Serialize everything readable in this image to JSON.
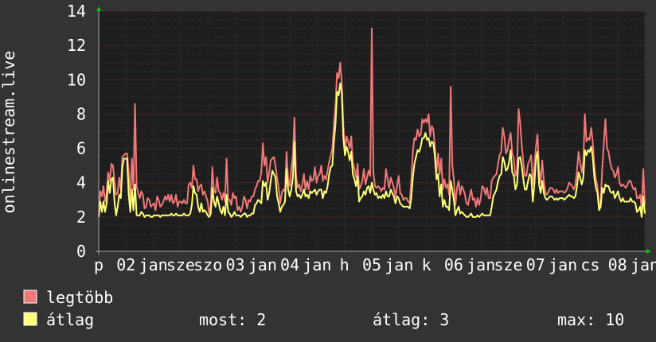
{
  "chart_data": {
    "type": "area",
    "ylabel": "onlinestream.live",
    "ylim": [
      0,
      14
    ],
    "y_ticks": [
      0,
      2,
      4,
      6,
      8,
      10,
      12,
      14
    ],
    "x_tick_labels": [
      "p",
      "02",
      "jan",
      "sze",
      "szo",
      "03",
      "jan",
      "04",
      "jan",
      "h",
      "05",
      "jan",
      "k",
      "06",
      "jan",
      "sze",
      "07",
      "jan",
      "cs",
      "08",
      "jan"
    ],
    "grid": true,
    "colors": {
      "background": "#333333",
      "plot_background": "#1e1e1e",
      "grid_major": "#6a2e2e",
      "grid_minor": "#3c3c3c",
      "legtobb": "#f07878",
      "atlag": "#ffff78",
      "arrow": "#00cc00"
    },
    "series": [
      {
        "name": "legtöbb",
        "color": "#f07878",
        "values": [
          2.1,
          3.5,
          3.2,
          3.8,
          2.9,
          3.4,
          4.6,
          4.1,
          5.1,
          5,
          4.1,
          3.3,
          3.4,
          4.3,
          3.6,
          5.5,
          5.6,
          5.7,
          5.7,
          4.6,
          2.9,
          5.4,
          3.6,
          8.6,
          3.8,
          3.4,
          3.1,
          3.5,
          3.3,
          2.5,
          2.6,
          3.1,
          3,
          2.6,
          2.7,
          2.8,
          2.4,
          3.2,
          3,
          2.6,
          2.7,
          2.9,
          3.2,
          3,
          3.3,
          2.9,
          3.3,
          2.8,
          2.9,
          3.3,
          2.6,
          2.9,
          2.9,
          2.8,
          3,
          2.8,
          2.8,
          3.9,
          4,
          3.7,
          5,
          4.2,
          4.2,
          3.5,
          3.8,
          3.9,
          3.3,
          3.5,
          3.2,
          2.9,
          2.2,
          2.7,
          4.9,
          3.5,
          3.4,
          4.3,
          3.5,
          3.4,
          3,
          3.4,
          2.9,
          5.4,
          3,
          3,
          2.7,
          3.4,
          3.1,
          3.2,
          2.4,
          2.6,
          2.3,
          2.6,
          3.2,
          3,
          2.5,
          3,
          2.9,
          3.2,
          3.2,
          3.6,
          3.8,
          4.1,
          4.1,
          4.6,
          6.3,
          5,
          5.5,
          4,
          4.6,
          5.3,
          5.4,
          5.5,
          5,
          4.3,
          3.7,
          2.8,
          3.4,
          3.6,
          3.5,
          5.8,
          4.2,
          3.8,
          4.8,
          5.6,
          7.8,
          4.5,
          3.7,
          3.9,
          3.5,
          3.9,
          4.5,
          3.6,
          4.1,
          3.6,
          4.4,
          4.1,
          4.2,
          4.9,
          4,
          4.4,
          4.5,
          5,
          4.1,
          4.4,
          4.2,
          4.7,
          5.2,
          5.6,
          6,
          7.4,
          8.5,
          10.4,
          10.1,
          11,
          9.8,
          7.3,
          5.9,
          6.7,
          6.4,
          6,
          6.7,
          5.2,
          4.8,
          4.3,
          5.1,
          3.6,
          3.8,
          4.1,
          4.8,
          3.9,
          4.3,
          4.7,
          4.4,
          13,
          4.6,
          3.8,
          3.7,
          3.8,
          3.7,
          3.5,
          3.7,
          3.6,
          4.8,
          4.2,
          3.7,
          4.3,
          4,
          3.7,
          3.2,
          3.8,
          4.4,
          3.4,
          3.3,
          3,
          3.1,
          3.1,
          2.9,
          2.8,
          4.1,
          5.8,
          6.6,
          6.5,
          7.1,
          6.7,
          6.8,
          7.7,
          7.5,
          7.7,
          7.5,
          8,
          6.7,
          7.3,
          7.1,
          6.1,
          4.6,
          5.7,
          4.5,
          5.4,
          3.6,
          4.2,
          3.7,
          3.9,
          3.3,
          9.6,
          5,
          4.2,
          2.7,
          3.7,
          4.1,
          3.3,
          3.8,
          3.6,
          3.3,
          2.8,
          2.7,
          3.2,
          3.6,
          3,
          3.1,
          2.6,
          3.1,
          2.7,
          3.1,
          3.8,
          3.7,
          3.3,
          3.7,
          3.1,
          3.1,
          4.1,
          4.3,
          4.4,
          4.5,
          5.1,
          5.6,
          5.8,
          7.2,
          6.7,
          5.7,
          5.9,
          6.5,
          6.9,
          5.7,
          5.4,
          4.4,
          4.7,
          8.3,
          7.5,
          6.2,
          5.2,
          4.4,
          4.4,
          5.1,
          5.3,
          5.6,
          3.9,
          5,
          6.1,
          6.8,
          4.8,
          4,
          5.3,
          4.1,
          3.4,
          3.3,
          3.5,
          3.7,
          3.7,
          3.6,
          3.4,
          3.6,
          3.4,
          3.5,
          3.5,
          3.5,
          3.4,
          3.5,
          3.7,
          4,
          3.9,
          3.8,
          3.6,
          3.9,
          4.7,
          5.8,
          5.2,
          4.6,
          5.2,
          8,
          6.4,
          6.6,
          6.5,
          7.2,
          6.4,
          5,
          4.2,
          3.8,
          2.6,
          2.9,
          4.8,
          6.3,
          7.7,
          6,
          5.8,
          5.2,
          4.8,
          4.7,
          4.3,
          4.5,
          4.9,
          4,
          3.8,
          3.9,
          3.8,
          3.7,
          3.9,
          4.1,
          4.1,
          3.8,
          3.6,
          3.7,
          3.1,
          3.1,
          3.3,
          2.5,
          4.8,
          2.7
        ]
      },
      {
        "name": "átlag",
        "color": "#ffff78",
        "values": [
          2,
          2.9,
          2.3,
          2.9,
          2.3,
          2.8,
          4.1,
          3.4,
          4.2,
          4.3,
          2.9,
          2.1,
          2.6,
          3.3,
          3.1,
          4.9,
          5.4,
          5.4,
          5.4,
          3.3,
          2.3,
          3.6,
          2.4,
          3.9,
          2.1,
          2.1,
          2.1,
          2.3,
          2.2,
          2,
          2.1,
          2.1,
          2.1,
          2,
          2,
          2.1,
          2.1,
          2.1,
          2.1,
          2,
          2.1,
          2.1,
          2.1,
          2.1,
          2.1,
          2.1,
          2.2,
          2.1,
          2.1,
          2.2,
          2.1,
          2.1,
          2.1,
          2.1,
          2.2,
          2.1,
          2.1,
          2.1,
          2.2,
          2.7,
          3.8,
          3.4,
          3.3,
          2.6,
          2.3,
          2.8,
          2.3,
          2.4,
          2.3,
          2.1,
          2,
          2.2,
          3.7,
          2.9,
          2.6,
          3.2,
          2.8,
          2.4,
          2.2,
          2.6,
          2.1,
          3.3,
          2.3,
          2.2,
          2,
          2.1,
          2.3,
          2.1,
          2.1,
          2.1,
          2,
          2.1,
          2.2,
          2.2,
          2,
          2.1,
          2.1,
          2.2,
          2.2,
          2.7,
          2.8,
          3,
          2.9,
          2.8,
          4.1,
          3.8,
          4,
          3,
          3.4,
          4.1,
          4.7,
          4.5,
          4.3,
          3.2,
          2.8,
          2.3,
          2.6,
          2.7,
          2.9,
          4.8,
          3.6,
          3.2,
          3.6,
          4.3,
          6.4,
          3.5,
          3.2,
          3.3,
          3.1,
          3.3,
          3.6,
          3.2,
          3.3,
          3.1,
          3.5,
          3.4,
          3.5,
          3.6,
          3.3,
          3.5,
          3.6,
          3.6,
          3.1,
          3.5,
          3.4,
          3.8,
          4.5,
          4.9,
          5,
          6.4,
          7.4,
          9.3,
          9.1,
          9.8,
          9.2,
          6.6,
          5.6,
          6.1,
          5.8,
          5.3,
          5.8,
          4.5,
          4.2,
          3.8,
          4.4,
          2.9,
          3.1,
          3.2,
          3.5,
          3.3,
          3.7,
          3.8,
          3.4,
          4,
          3.6,
          3.3,
          3.4,
          3.1,
          3.2,
          3.1,
          3.3,
          3.1,
          3.5,
          3.2,
          3.2,
          3.6,
          3.4,
          3.2,
          2.8,
          3.2,
          3.1,
          2.8,
          2.7,
          2.6,
          2.6,
          2.6,
          2.6,
          2.5,
          3.1,
          4.3,
          5.1,
          5.5,
          5.9,
          5.8,
          6.1,
          6.6,
          6.6,
          6.9,
          6.5,
          6.6,
          6.1,
          6.4,
          6.3,
          5.5,
          4.2,
          4.5,
          3.2,
          3.9,
          2.6,
          3,
          2.6,
          2.6,
          2.4,
          4.1,
          3.6,
          3,
          2.1,
          2.4,
          2.6,
          2.2,
          2.3,
          2.2,
          2.1,
          2,
          2,
          2.1,
          2.2,
          2,
          2,
          2,
          2.1,
          2,
          2.1,
          2.2,
          2.1,
          2.1,
          2.1,
          2.1,
          2.1,
          2.6,
          3.2,
          3.4,
          3.6,
          4.1,
          4.4,
          4.5,
          5.5,
          5.2,
          4.7,
          4.8,
          5.2,
          5.9,
          4.6,
          4.4,
          3.6,
          3.9,
          5.4,
          5.5,
          5,
          4.2,
          3.6,
          3.6,
          4.1,
          4.5,
          4.4,
          2.9,
          3.9,
          5.4,
          5.8,
          3.9,
          3.4,
          4.1,
          3.4,
          3.1,
          3,
          3.1,
          3.2,
          3.2,
          3.1,
          3,
          3.1,
          3,
          3.1,
          3.1,
          3.1,
          3,
          3.1,
          3.2,
          3.3,
          3.2,
          3.2,
          3.1,
          3.2,
          3.8,
          4.6,
          4.3,
          3.9,
          4.3,
          5.9,
          5.6,
          5.9,
          5.8,
          6.1,
          5.5,
          4.3,
          3.7,
          3.4,
          2.4,
          2.6,
          3.7,
          3.4,
          3.9,
          3.8,
          3.8,
          3.5,
          3.4,
          3.5,
          3.1,
          3.3,
          3.5,
          3.1,
          2.9,
          3.1,
          2.9,
          2.9,
          2.9,
          2.9,
          3.1,
          2.9,
          2.9,
          2.8,
          2.3,
          2.4,
          2.6,
          2,
          3.2,
          2.2
        ]
      }
    ]
  },
  "legend": [
    {
      "label": "legtöbb",
      "color": "#f07878"
    },
    {
      "label": "átlag",
      "color": "#ffff78"
    }
  ],
  "stats": {
    "most": "most: 2",
    "atlag": "átlag: 3",
    "max": "max: 10"
  }
}
